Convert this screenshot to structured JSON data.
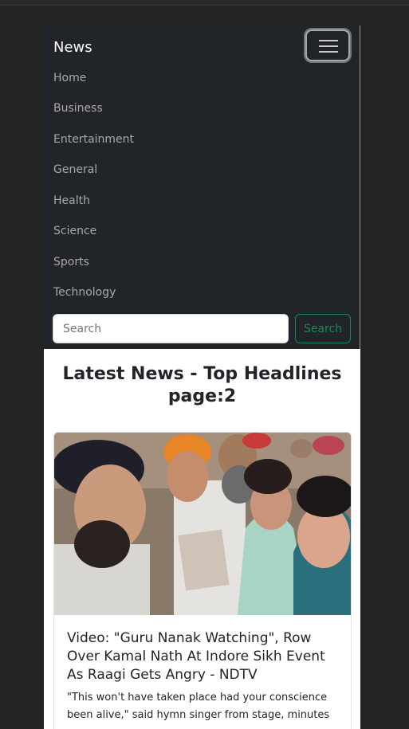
{
  "navbar": {
    "brand": "News",
    "items": [
      {
        "label": "Home"
      },
      {
        "label": "Business"
      },
      {
        "label": "Entertainment"
      },
      {
        "label": "General"
      },
      {
        "label": "Health"
      },
      {
        "label": "Science"
      },
      {
        "label": "Sports"
      },
      {
        "label": "Technology"
      }
    ],
    "search": {
      "placeholder": "Search",
      "button_label": "Search"
    }
  },
  "main": {
    "heading": "Latest News - Top Headlines page:2",
    "articles": [
      {
        "title": "Video: \"Guru Nanak Watching\", Row Over Kamal Nath At Indore Sikh Event As Raagi Gets Angry - NDTV",
        "description": "\"This won't have taken place had your conscience been alive,\" said hymn singer from stage, minutes"
      }
    ]
  },
  "colors": {
    "navbar_bg": "#212529",
    "success": "#198754"
  }
}
